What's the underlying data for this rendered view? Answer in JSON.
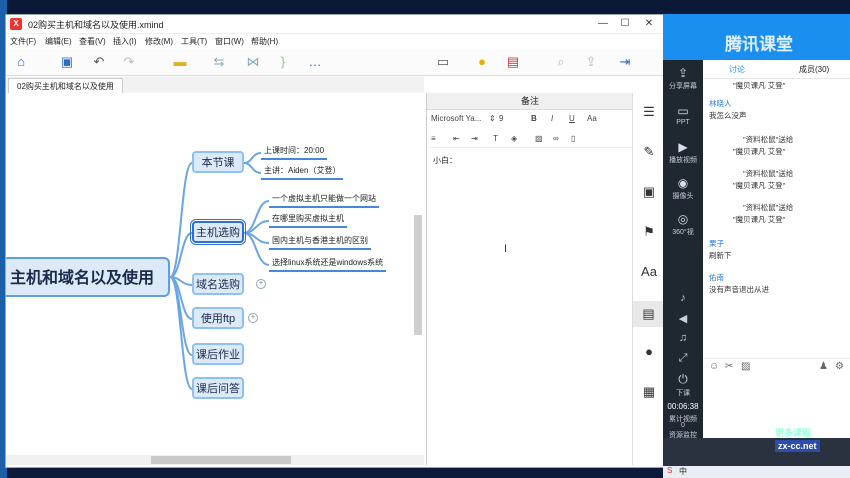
{
  "window": {
    "title": "02购买主机和域名以及使用.xmind",
    "logo_text": "X"
  },
  "menu": [
    "文件(F)",
    "编辑(E)",
    "查看(V)",
    "插入(I)",
    "修改(M)",
    "工具(T)",
    "窗口(W)",
    "帮助(H)"
  ],
  "tab": {
    "label": "02购买主机和域名以及使用"
  },
  "mindmap": {
    "central": "主机和域名以及使用",
    "topics": [
      {
        "label": "本节课",
        "children": [
          "上课时间：20:00",
          "主讲：Aiden（艾登）"
        ]
      },
      {
        "label": "主机选购",
        "selected": true,
        "children": [
          "一个虚拟主机只能做一个网站",
          "在哪里购买虚拟主机",
          "国内主机与香港主机的区别",
          "选择linux系统还是windows系统"
        ]
      },
      {
        "label": "域名选购",
        "collapsed": true
      },
      {
        "label": "使用ftp",
        "collapsed": true
      },
      {
        "label": "课后作业"
      },
      {
        "label": "课后问答"
      }
    ]
  },
  "notes": {
    "header": "备注",
    "font": "Microsoft Ya...",
    "size": "9",
    "bold": "B",
    "italic": "I",
    "underline": "U",
    "case": "Aa",
    "text": "小白："
  },
  "tencent": {
    "brand": "腾讯课堂",
    "left_buttons": [
      {
        "icon": "share-icon",
        "label": "分享屏幕"
      },
      {
        "icon": "ppt-icon",
        "label": "PPT"
      },
      {
        "icon": "video-icon",
        "label": "播放视频"
      },
      {
        "icon": "camera-icon",
        "label": "摄像头"
      },
      {
        "icon": "vr-icon",
        "label": "360°视"
      }
    ],
    "tabs": [
      "讨论",
      "成员(30)"
    ],
    "chat": [
      {
        "text": "\"魔贝课凡 艾登\"",
        "type": "gift"
      },
      {
        "name": "林晓人",
        "text": "我怎么没声",
        "type": "user"
      },
      {
        "text": "\"资料松鼠\"送给",
        "type": "gift"
      },
      {
        "text": "\"魔贝课凡 艾登\"",
        "type": "gift"
      },
      {
        "text": "\"资料松鼠\"送给",
        "type": "gift"
      },
      {
        "text": "\"魔贝课凡 艾登\"",
        "type": "gift"
      },
      {
        "text": "\"资料松鼠\"送给",
        "type": "gift"
      },
      {
        "text": "\"魔贝课凡 艾登\"",
        "type": "gift"
      },
      {
        "name": "栗子",
        "text": "刷新下",
        "type": "user"
      },
      {
        "name": "佑南",
        "text": "没有声音退出从进",
        "type": "user"
      }
    ],
    "timer": "00:06:38",
    "stats": "累计视频",
    "stats2": "0",
    "stats3": "资源监控",
    "down_label": "下课",
    "watermark1": "更多课程",
    "watermark2": "zx-cc.net"
  },
  "taskbar": {
    "ime": "中"
  }
}
